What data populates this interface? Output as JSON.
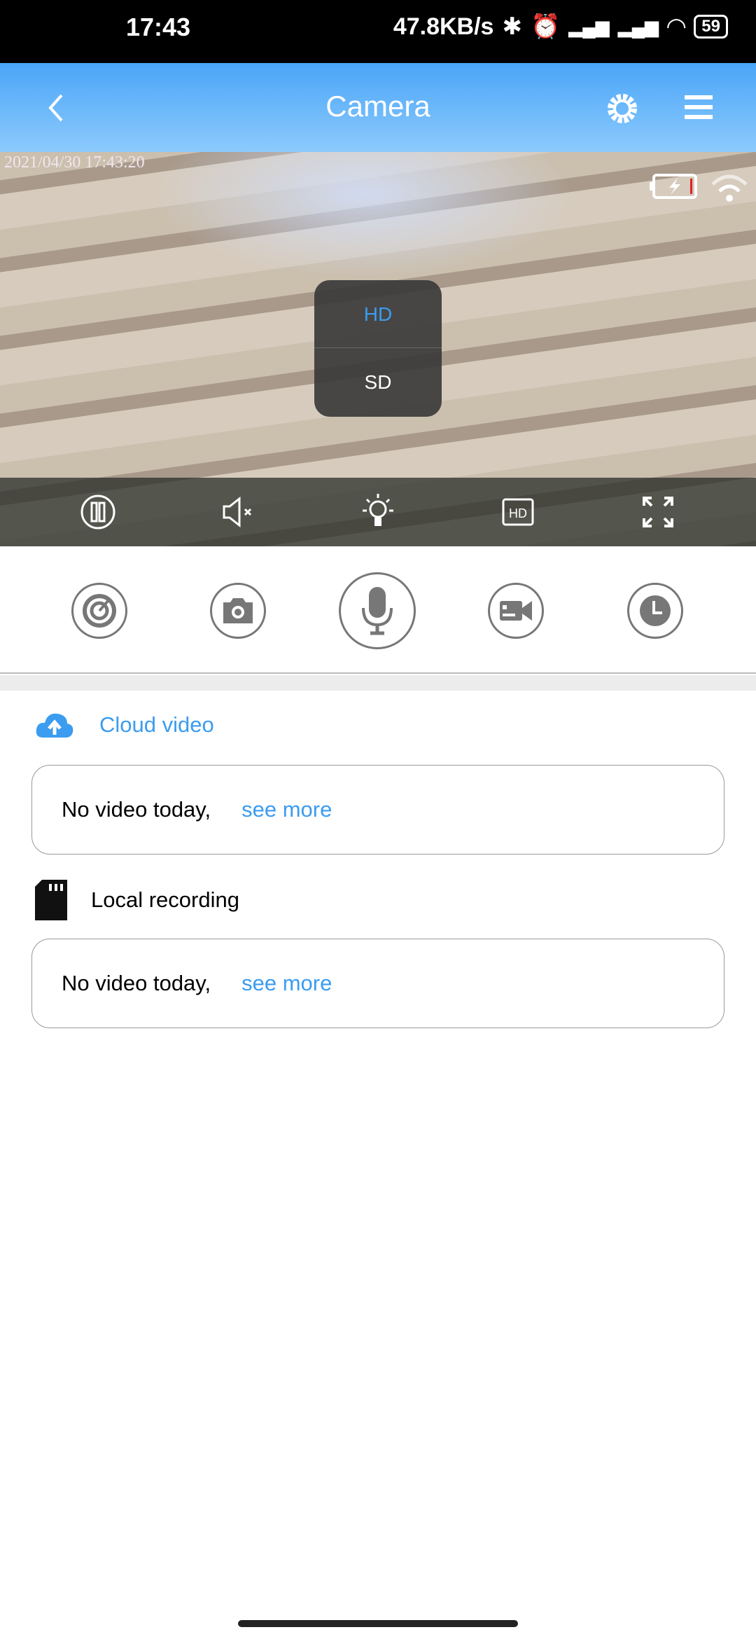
{
  "status_bar": {
    "time": "17:43",
    "net_speed": "47.8KB/s",
    "battery": "59"
  },
  "header": {
    "title": "Camera",
    "icons": [
      "back-icon",
      "settings-icon",
      "menu-icon"
    ]
  },
  "video": {
    "timestamp": "2021/04/30 17:43:20",
    "quality_options": [
      "HD",
      "SD"
    ],
    "selected_quality": "HD",
    "hd_badge": "HD"
  },
  "colors": {
    "accent": "#3b9cf0",
    "header_top": "#4aa5f8",
    "header_bottom": "#8ccafc"
  },
  "cloud": {
    "title": "Cloud video",
    "empty": "No video today,",
    "see_more": "see more"
  },
  "local": {
    "title": "Local recording",
    "empty": "No video today,",
    "see_more": "see more"
  }
}
